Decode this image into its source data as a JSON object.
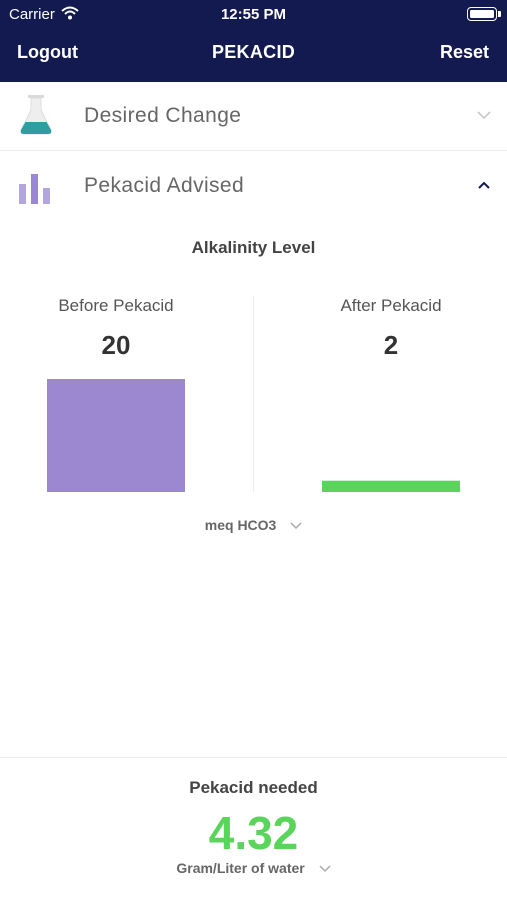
{
  "status_bar": {
    "carrier": "Carrier",
    "time": "12:55 PM",
    "wifi_icon": "wifi-icon",
    "battery_icon": "battery-icon"
  },
  "nav": {
    "logout": "Logout",
    "title": "PEKACID",
    "reset": "Reset"
  },
  "sections": {
    "desired_change": {
      "label": "Desired Change",
      "icon": "flask-icon",
      "expanded": false
    },
    "pekacid_advised": {
      "label": "Pekacid Advised",
      "icon": "bar-chart-icon",
      "expanded": true
    }
  },
  "chart_data": {
    "type": "bar",
    "title": "Alkalinity Level",
    "categories": [
      "Before Pekacid",
      "After Pekacid"
    ],
    "values": [
      20,
      2
    ],
    "colors": [
      "#9b88d0",
      "#5ad45a"
    ],
    "unit": "meq HCO3"
  },
  "result": {
    "label": "Pekacid needed",
    "value": "4.32",
    "unit": "Gram/Liter of water",
    "value_color": "#5ad45a"
  },
  "theme": {
    "nav_bg": "#121a4f",
    "flask_liquid": "#2e9ea0",
    "chart_icon": "#9b88d0"
  }
}
